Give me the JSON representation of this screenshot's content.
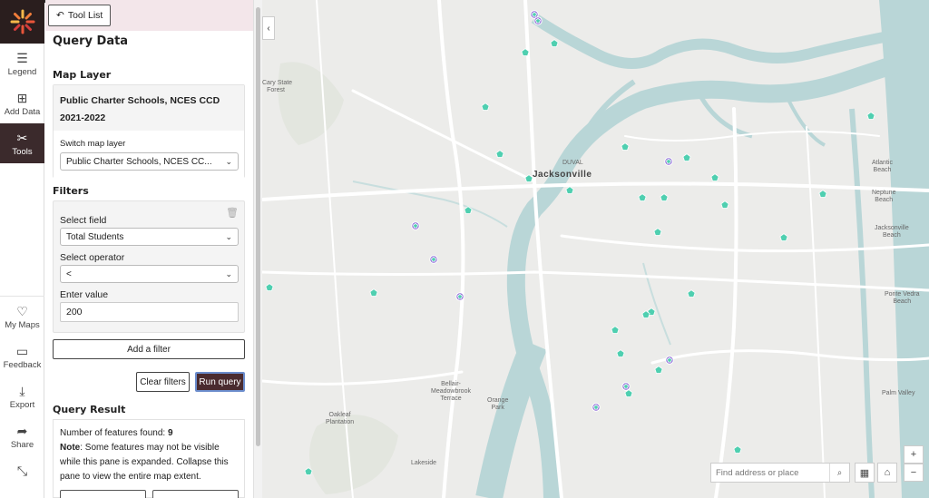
{
  "rail": {
    "items": [
      {
        "label": "Legend",
        "icon": "list-icon"
      },
      {
        "label": "Add Data",
        "icon": "add-data-icon"
      },
      {
        "label": "Tools",
        "icon": "tools-icon",
        "active": true
      },
      {
        "label": "My Maps",
        "icon": "heart-icon"
      },
      {
        "label": "Feedback",
        "icon": "chat-icon"
      },
      {
        "label": "Export",
        "icon": "download-icon"
      },
      {
        "label": "Share",
        "icon": "share-icon"
      }
    ]
  },
  "panel": {
    "tool_list_label": "Tool List",
    "title": "Query Data",
    "map_layer_heading": "Map Layer",
    "layer_name": "Public Charter Schools, NCES CCD 2021-2022",
    "switch_label": "Switch map layer",
    "switch_value": "Public Charter Schools, NCES CC...",
    "filters_heading": "Filters",
    "select_field_label": "Select field",
    "select_field_value": "Total Students",
    "select_operator_label": "Select operator",
    "select_operator_value": "<",
    "enter_value_label": "Enter value",
    "enter_value": "200",
    "add_filter_label": "Add a filter",
    "clear_filters_label": "Clear filters",
    "run_query_label": "Run query",
    "result_heading": "Query Result",
    "features_found_text": "Number of features found:",
    "features_found_count": "9",
    "note_label": "Note",
    "note_text": ": Some features may not be visible while this pane is expanded. Collapse this pane to view the entire map extent."
  },
  "map": {
    "labels": {
      "jacksonville": "Jacksonville",
      "duval": "DUVAL",
      "cary": "Cary State\nForest",
      "atlantic": "Atlantic\nBeach",
      "neptune": "Neptune\nBeach",
      "jaxbeach": "Jacksonville\nBeach",
      "pontevedra": "Ponte Vedra\nBeach",
      "palmvalley": "Palm Valley",
      "bellair": "Bellair-\nMeadowbrook\nTerrace",
      "orangepark": "Orange\nPark",
      "oakleaf": "Oakleaf\nPlantation",
      "lakeside": "Lakeside"
    },
    "search_placeholder": "Find address or place",
    "colors": {
      "water": "#b9d6d7",
      "land": "#ececea",
      "road": "#ffffff",
      "school_point": "#4fcfb0",
      "query_point": "#8e6bd8",
      "accent": "#4a2b2f"
    }
  }
}
